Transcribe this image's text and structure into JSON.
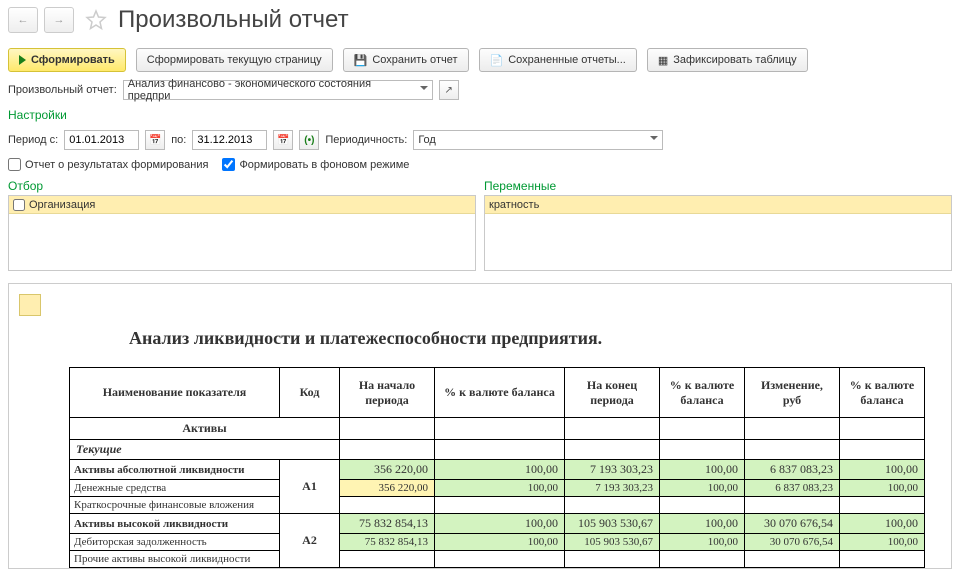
{
  "header": {
    "title": "Произвольный отчет"
  },
  "toolbar": {
    "form": "Сформировать",
    "form_page": "Сформировать текущую страницу",
    "save": "Сохранить отчет",
    "saved": "Сохраненные отчеты...",
    "fix": "Зафиксировать таблицу"
  },
  "reportSelect": {
    "label": "Произвольный отчет:",
    "value": "Анализ финансово - экономического состояния предпри"
  },
  "settings": {
    "title": "Настройки",
    "period_from_label": "Период с:",
    "period_from": "01.01.2013",
    "period_to_label": "по:",
    "period_to": "31.12.2013",
    "periodicity_label": "Периодичность:",
    "periodicity_value": "Год",
    "cb_results": "Отчет о результатах формирования",
    "cb_bg": "Формировать в фоновом режиме"
  },
  "panels": {
    "filter": "Отбор",
    "filter_field": "Организация",
    "vars": "Переменные",
    "vars_field": "кратность"
  },
  "report": {
    "title": "Анализ ликвидности и платежеспособности предприятия.",
    "cols": {
      "name": "Наименование показателя",
      "code": "Код",
      "start": "На начало периода",
      "pct_start": "% к валюте баланса",
      "end": "На конец периода",
      "pct_end": "% к валюте баланса",
      "change": "Изменение, руб",
      "pct_change": "% к валюте баланса"
    },
    "sections": {
      "assets": "Активы",
      "current": "Текущие"
    },
    "rows": {
      "a1": {
        "name": "Активы абсолютной ликвидности",
        "code": "А1",
        "start": "356 220,00",
        "pct_start": "100,00",
        "end": "7 193 303,23",
        "pct_end": "100,00",
        "change": "6 837 083,23",
        "pct_change": "100,00",
        "sub1": "Денежные средства",
        "sub1_start": "356 220,00",
        "sub1_pct_start": "100,00",
        "sub1_end": "7 193 303,23",
        "sub1_pct_end": "100,00",
        "sub1_change": "6 837 083,23",
        "sub1_pct_change": "100,00",
        "sub2": "Краткосрочные финансовые вложения"
      },
      "a2": {
        "name": "Активы высокой ликвидности",
        "code": "А2",
        "start": "75 832 854,13",
        "pct_start": "100,00",
        "end": "105 903 530,67",
        "pct_end": "100,00",
        "change": "30 070 676,54",
        "pct_change": "100,00",
        "sub1": "Дебиторская задолженность",
        "sub1_start": "75 832 854,13",
        "sub1_pct_start": "100,00",
        "sub1_end": "105 903 530,67",
        "sub1_pct_end": "100,00",
        "sub1_change": "30 070 676,54",
        "sub1_pct_change": "100,00",
        "sub2": "Прочие активы высокой ликвидности"
      }
    }
  }
}
